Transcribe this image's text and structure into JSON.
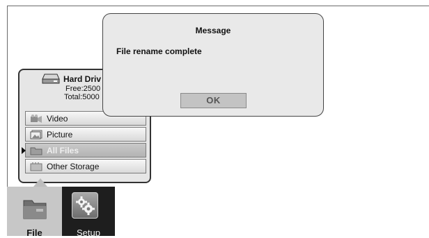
{
  "dialog": {
    "title": "Message",
    "message": "File rename complete",
    "ok_label": "OK"
  },
  "storage": {
    "title": "Hard Driv",
    "free": "Free:2500",
    "total": "Total:5000"
  },
  "menu": {
    "items": [
      {
        "label": "Video",
        "icon": "video-icon",
        "selected": false
      },
      {
        "label": "Picture",
        "icon": "picture-icon",
        "selected": false
      },
      {
        "label": "All Files",
        "icon": "folder-icon",
        "selected": true
      },
      {
        "label": "Other Storage",
        "icon": "storage-icon",
        "selected": false
      }
    ]
  },
  "tabs": {
    "file_label": "File",
    "setup_label": "Setup",
    "active": "File"
  }
}
